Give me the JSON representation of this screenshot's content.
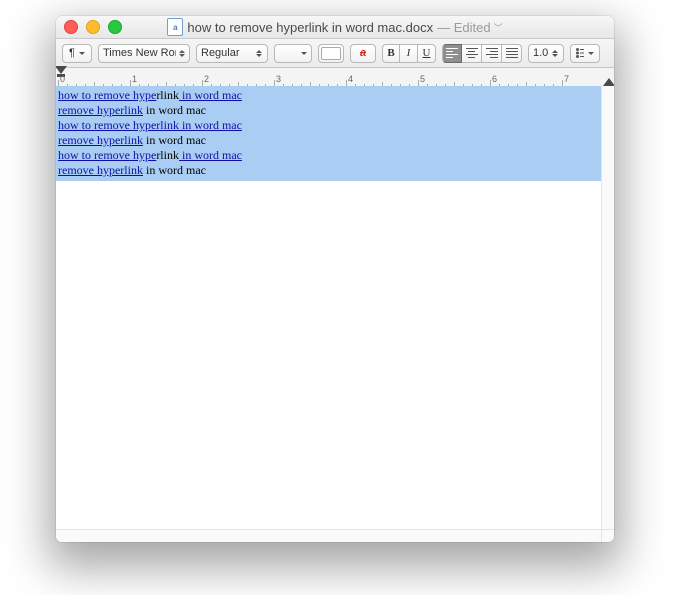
{
  "titlebar": {
    "doc_letter": "a",
    "filename": "how to remove hyperlink in word mac.docx",
    "edited_label": "— Edited"
  },
  "toolbar": {
    "style_label": "¶",
    "font_family": "Times New Rom…",
    "font_style": "Regular",
    "font_size": "",
    "bold": "B",
    "italic": "I",
    "underline": "U",
    "spacing": "1.0"
  },
  "ruler": {
    "labels": [
      "0",
      "1",
      "2",
      "3",
      "4",
      "5",
      "6",
      "7"
    ]
  },
  "document": {
    "lines": [
      {
        "link": "how to remove hype",
        "mid": "rlink",
        "tail": " in word mac"
      },
      {
        "link": "remove hyperlink",
        "mid": " in word mac",
        "tail": ""
      },
      {
        "link": "how to remove hyperlink in word mac",
        "mid": "",
        "tail": ""
      },
      {
        "link": "remove hyperlink",
        "mid": " in word mac",
        "tail": ""
      },
      {
        "link": "how to remove hype",
        "mid": "rlink",
        "tail": " in word mac"
      },
      {
        "link": "remove hyperlink",
        "mid": " in word mac",
        "tail": ""
      }
    ]
  }
}
